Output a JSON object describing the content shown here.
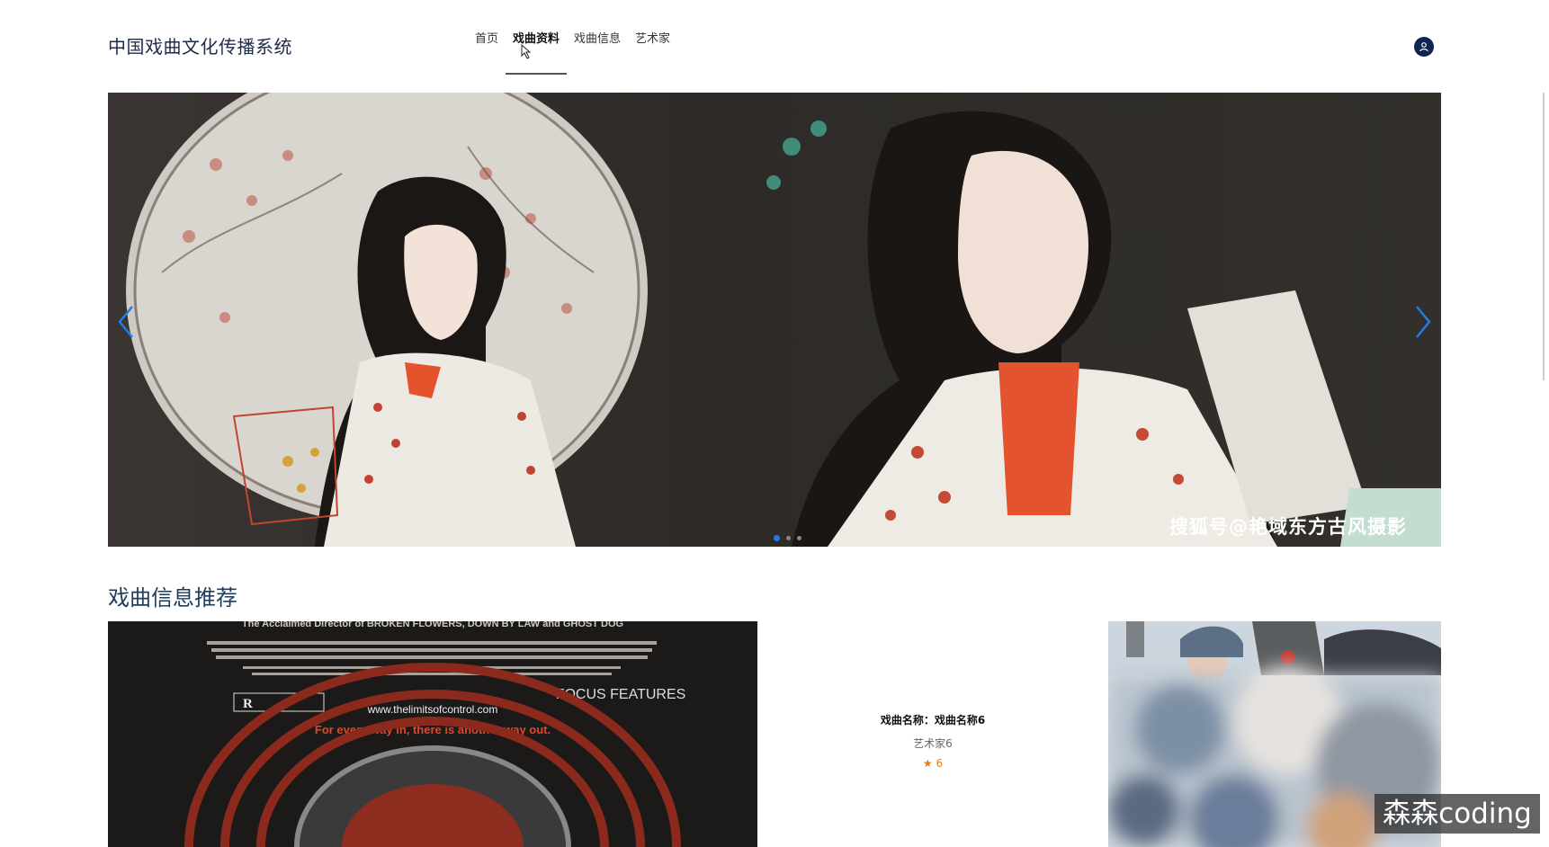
{
  "header": {
    "site_title": "中国戏曲文化传播系统",
    "nav": [
      {
        "label": "首页"
      },
      {
        "label": "戏曲资料",
        "active": true
      },
      {
        "label": "戏曲信息"
      },
      {
        "label": "艺术家"
      }
    ]
  },
  "banner": {
    "caption": "搜狐号@艳域东方古风摄影",
    "slides": 3,
    "active_slide": 1
  },
  "recommend": {
    "title": "戏曲信息推荐",
    "poster_lines": [
      "The Acclaimed Director of BROKEN FLOWERS, DOWN BY LAW and GHOST DOG",
      "FOCUS FEATURES",
      "www.thelimitsofcontrol.com",
      "For every way in, there is another way out."
    ],
    "card": {
      "name": "戏曲名称：戏曲名称6",
      "artist": "艺术家6",
      "star": "★",
      "rating": "6"
    }
  },
  "watermark": "森森coding",
  "colors": {
    "accent": "#1a7fe8",
    "title": "#1d3d5c",
    "rating": "#e87b1c",
    "user_icon_bg": "#0f2550"
  }
}
